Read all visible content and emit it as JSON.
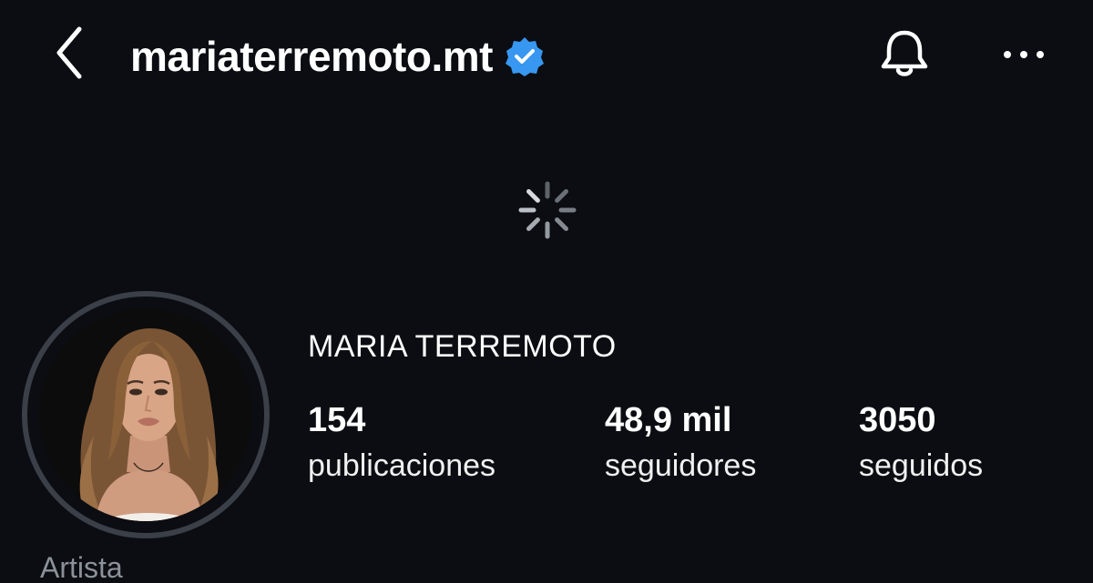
{
  "header": {
    "username": "mariaterremoto.mt",
    "back_icon": "chevron-left-icon",
    "verified_icon": "verified-badge-icon",
    "bell_icon": "bell-icon",
    "more_icon": "more-horizontal-icon"
  },
  "loading": {
    "icon": "spinner-icon"
  },
  "profile": {
    "full_name": "MARIA TERREMOTO",
    "category": "Artista",
    "stats": [
      {
        "value": "154",
        "label": "publicaciones"
      },
      {
        "value": "48,9 mil",
        "label": "seguidores"
      },
      {
        "value": "3050",
        "label": "seguidos"
      }
    ]
  },
  "colors": {
    "background": "#0b0d12",
    "verified_blue": "#3897f0",
    "text_primary": "#ffffff",
    "text_secondary": "#8c9199",
    "avatar_ring": "#3a3f48"
  }
}
